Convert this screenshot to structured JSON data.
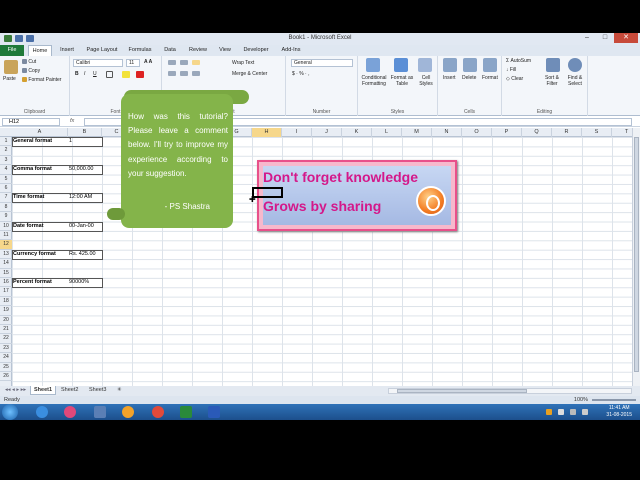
{
  "window": {
    "title": "Book1 - Microsoft Excel"
  },
  "tabs": {
    "file": "File",
    "items": [
      "Home",
      "Insert",
      "Page Layout",
      "Formulas",
      "Data",
      "Review",
      "View",
      "Developer",
      "Add-Ins"
    ],
    "active": "Home"
  },
  "ribbon": {
    "clipboard": {
      "name": "Clipboard",
      "paste": "Paste",
      "cut": "Cut",
      "copy": "Copy",
      "format_painter": "Format Painter"
    },
    "font": {
      "name": "Font",
      "font_name": "Calibri",
      "font_size": "11"
    },
    "alignment": {
      "name": "Alignment",
      "wrap": "Wrap Text",
      "merge": "Merge & Center"
    },
    "number": {
      "name": "Number",
      "format": "General"
    },
    "styles": {
      "name": "Styles",
      "conditional": "Conditional Formatting",
      "format_table": "Format as Table",
      "cell_styles": "Cell Styles"
    },
    "cells": {
      "name": "Cells",
      "insert": "Insert",
      "delete": "Delete",
      "format": "Format"
    },
    "editing": {
      "name": "Editing",
      "autosum": "AutoSum",
      "fill": "Fill",
      "clear": "Clear",
      "sort": "Sort & Filter",
      "find": "Find & Select"
    }
  },
  "formula_bar": {
    "name_box": "H12",
    "fx": "fx",
    "value": ""
  },
  "columns": [
    "A",
    "B",
    "C",
    "D",
    "E",
    "F",
    "G",
    "H",
    "I",
    "J",
    "K",
    "L",
    "M",
    "N",
    "O",
    "P",
    "Q",
    "R",
    "S",
    "T",
    "U"
  ],
  "rows": [
    "1",
    "2",
    "3",
    "4",
    "5",
    "6",
    "7",
    "8",
    "9",
    "10",
    "11",
    "12",
    "13",
    "14",
    "15",
    "16",
    "17",
    "18",
    "19",
    "20",
    "21",
    "22",
    "23",
    "24",
    "25",
    "26"
  ],
  "sheet": {
    "cells": [
      {
        "row": 1,
        "label": "General format",
        "value": "1"
      },
      {
        "row": 4,
        "label": "Comma format",
        "value": "50,000.00"
      },
      {
        "row": 7,
        "label": "Time format",
        "value": "12:00 AM"
      },
      {
        "row": 10,
        "label": "Date format",
        "value": "00-Jan-00"
      },
      {
        "row": 13,
        "label": "Currency format",
        "value": "Rs. 425.00"
      },
      {
        "row": 16,
        "label": "Percent format",
        "value": "90000%"
      }
    ]
  },
  "note": {
    "text": "How was this tutorial? Please leave a comment below. I'll try to improve my experience according to your suggestion.",
    "signature": "- PS Shastra"
  },
  "banner": {
    "line1": "Don't forget knowledge",
    "line2": "Grows by sharing"
  },
  "sheet_tabs": [
    "Sheet1",
    "Sheet2",
    "Sheet3"
  ],
  "status": {
    "ready": "Ready",
    "zoom": "100%"
  },
  "taskbar": {
    "time": "11:41 AM",
    "date": "31-08-2015"
  },
  "colors": {
    "excel_green": "#1f7a3a",
    "note_green": "#84b44a",
    "banner_pink": "#d4188a"
  }
}
